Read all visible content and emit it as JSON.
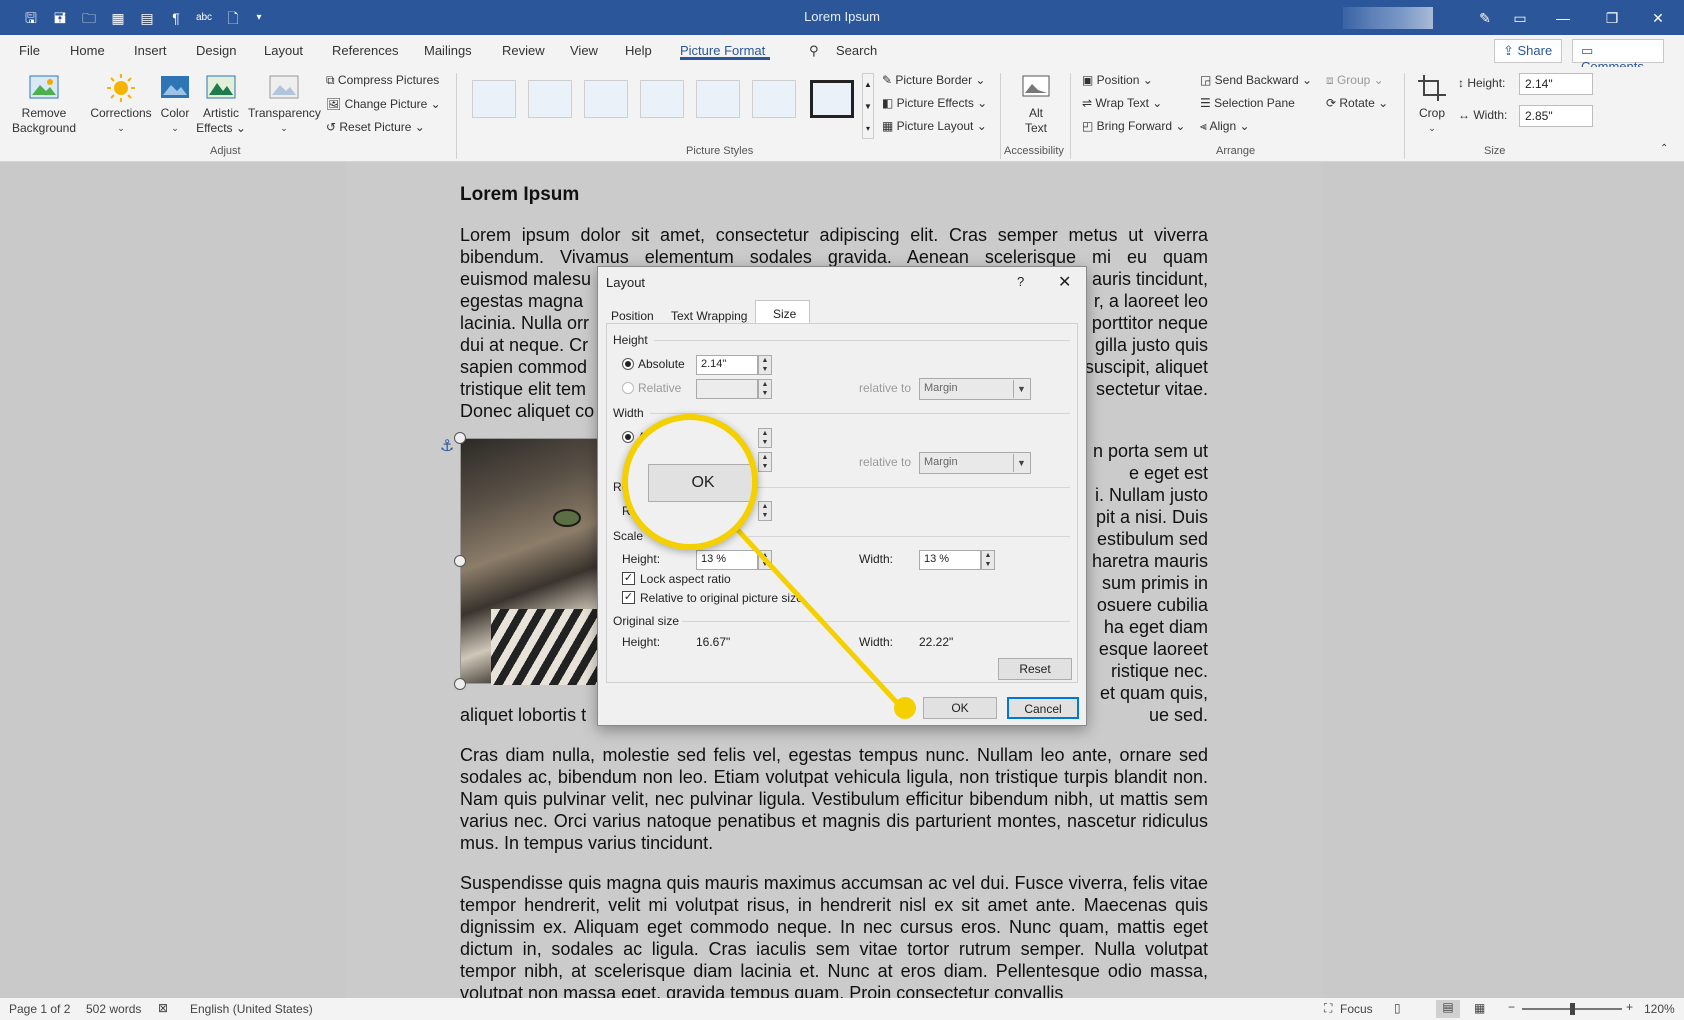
{
  "window": {
    "title": "Lorem Ipsum"
  },
  "menu_tabs": [
    "File",
    "Home",
    "Insert",
    "Design",
    "Layout",
    "References",
    "Mailings",
    "Review",
    "View",
    "Help",
    "Picture Format"
  ],
  "search": {
    "label": "Search"
  },
  "top_right": {
    "share": "Share",
    "comments": "Comments"
  },
  "ribbon": {
    "remove_background": [
      "Remove",
      "Background"
    ],
    "corrections": "Corrections",
    "color": "Color",
    "artistic_effects": [
      "Artistic",
      "Effects"
    ],
    "transparency": "Transparency",
    "compress": "Compress Pictures",
    "change_picture": "Change Picture",
    "reset_picture": "Reset Picture",
    "group_adjust": "Adjust",
    "group_styles": "Picture Styles",
    "picture_border": "Picture Border",
    "picture_effects": "Picture Effects",
    "picture_layout": "Picture Layout",
    "alt_text": [
      "Alt",
      "Text"
    ],
    "group_accessibility": "Accessibility",
    "position": "Position",
    "wrap_text": "Wrap Text",
    "bring_forward": "Bring Forward",
    "send_backward": "Send Backward",
    "selection_pane": "Selection Pane",
    "align": "Align",
    "group_btn": "Group",
    "rotate": "Rotate",
    "group_arrange": "Arrange",
    "crop": "Crop",
    "height_label": "Height:",
    "height_value": "2.14\"",
    "width_label": "Width:",
    "width_value": "2.85\"",
    "group_size": "Size"
  },
  "document": {
    "heading": "Lorem Ipsum",
    "para1_lines": [
      "Lorem ipsum dolor sit amet, consectetur adipiscing elit. Cras semper metus ut viverra",
      "bibendum. Vivamus elementum sodales gravida. Aenean scelerisque mi eu quam",
      "euismod malesu",
      "egestas magna",
      "lacinia. Nulla orr",
      "dui at neque. Cr",
      "sapien commod",
      "tristique elit tem",
      "Donec aliquet co"
    ],
    "para1_right": [
      "",
      "",
      "auris tincidunt,",
      "r, a laoreet leo",
      "porttitor neque",
      "gilla justo quis",
      "suscipit, aliquet",
      "sectetur vitae.",
      ""
    ],
    "wrap_right": [
      "n porta sem ut",
      "e eget est",
      "i. Nullam justo",
      "pit a nisi. Duis",
      "estibulum sed",
      "haretra mauris",
      "sum primis in",
      "osuere cubilia",
      "ha eget diam",
      "esque laoreet",
      "ristique nec.",
      "et quam quis,"
    ],
    "wrap_last_left": "aliquet lobortis t",
    "wrap_last_right": "ue sed.",
    "para2": "Cras diam nulla, molestie sed felis vel, egestas tempus nunc. Nullam leo ante, ornare sed sodales ac, bibendum non leo. Etiam volutpat vehicula ligula, non tristique turpis blandit non. Nam quis pulvinar velit, nec pulvinar ligula. Vestibulum efficitur bibendum nibh, ut mattis sem varius nec. Orci varius natoque penatibus et magnis dis parturient montes, nascetur ridiculus mus. In tempus varius tincidunt.",
    "para3": "Suspendisse quis magna quis mauris maximus accumsan ac vel dui. Fusce viverra, felis vitae tempor hendrerit, velit mi volutpat risus, in hendrerit nisl ex sit amet ante. Maecenas quis dignissim ex. Aliquam eget commodo neque. In nec cursus eros. Nunc quam, mattis eget dictum in, sodales ac ligula. Cras iaculis sem vitae tortor rutrum semper. Nulla volutpat tempor nibh, at scelerisque diam lacinia et. Nunc at eros diam. Pellentesque odio massa, volutpat non massa eget, gravida tempus quam. Proin consectetur convallis"
  },
  "dialog": {
    "title": "Layout",
    "help": "?",
    "tabs": [
      "Position",
      "Text Wrapping",
      "Size"
    ],
    "height_section": "Height",
    "absolute": "Absolute",
    "absolute_value": "2.14\"",
    "relative": "Relative",
    "relative_to": "relative to",
    "margin": "Margin",
    "width_section": "Width",
    "width_abs_partial": "A",
    "rotate_section_partial": "Rota",
    "rotation_partial": "Rot",
    "scale_section": "Scale",
    "scale_height_label": "Height:",
    "scale_height_value": "13 %",
    "scale_width_label": "Width:",
    "scale_width_value": "13 %",
    "lock_aspect": "Lock aspect ratio",
    "relative_original": "Relative to original picture size",
    "original_size": "Original size",
    "orig_height_label": "Height:",
    "orig_height_value": "16.67\"",
    "orig_width_label": "Width:",
    "orig_width_value": "22.22\"",
    "reset": "Reset",
    "ok": "OK",
    "cancel": "Cancel"
  },
  "callout": {
    "label": "OK",
    "color": "#f5d000"
  },
  "status": {
    "page": "Page 1 of 2",
    "words": "502 words",
    "language": "English (United States)",
    "focus": "Focus",
    "zoom": "120%"
  }
}
